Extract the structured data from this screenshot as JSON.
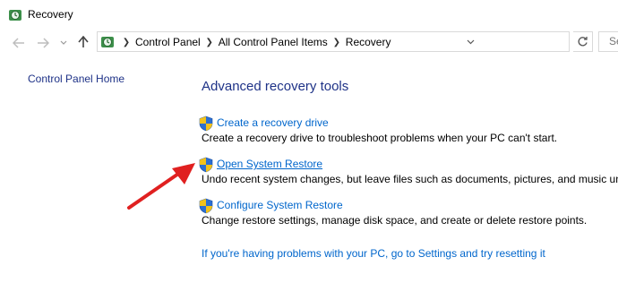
{
  "window": {
    "title": "Recovery"
  },
  "address": {
    "crumbs": [
      "Control Panel",
      "All Control Panel Items",
      "Recovery"
    ],
    "search_placeholder": "Se"
  },
  "sidebar": {
    "home_link": "Control Panel Home"
  },
  "main": {
    "title": "Advanced recovery tools",
    "tools": [
      {
        "label": "Create a recovery drive",
        "desc": "Create a recovery drive to troubleshoot problems when your PC can't start."
      },
      {
        "label": "Open System Restore",
        "desc": "Undo recent system changes, but leave files such as documents, pictures, and music unc"
      },
      {
        "label": "Configure System Restore",
        "desc": "Change restore settings, manage disk space, and create or delete restore points."
      }
    ],
    "reset_link": "If you're having problems with your PC, go to Settings and try resetting it"
  },
  "icons": {
    "app": "recovery-icon",
    "back": "back-arrow-icon",
    "forward": "forward-arrow-icon",
    "history": "chevron-down-icon",
    "up": "up-arrow-icon",
    "shield": "uac-shield-icon",
    "refresh": "refresh-icon",
    "annotation": "red-arrow-annotation"
  },
  "colors": {
    "link": "#0066cc",
    "heading": "#1e3287",
    "arrow": "#e02020"
  }
}
